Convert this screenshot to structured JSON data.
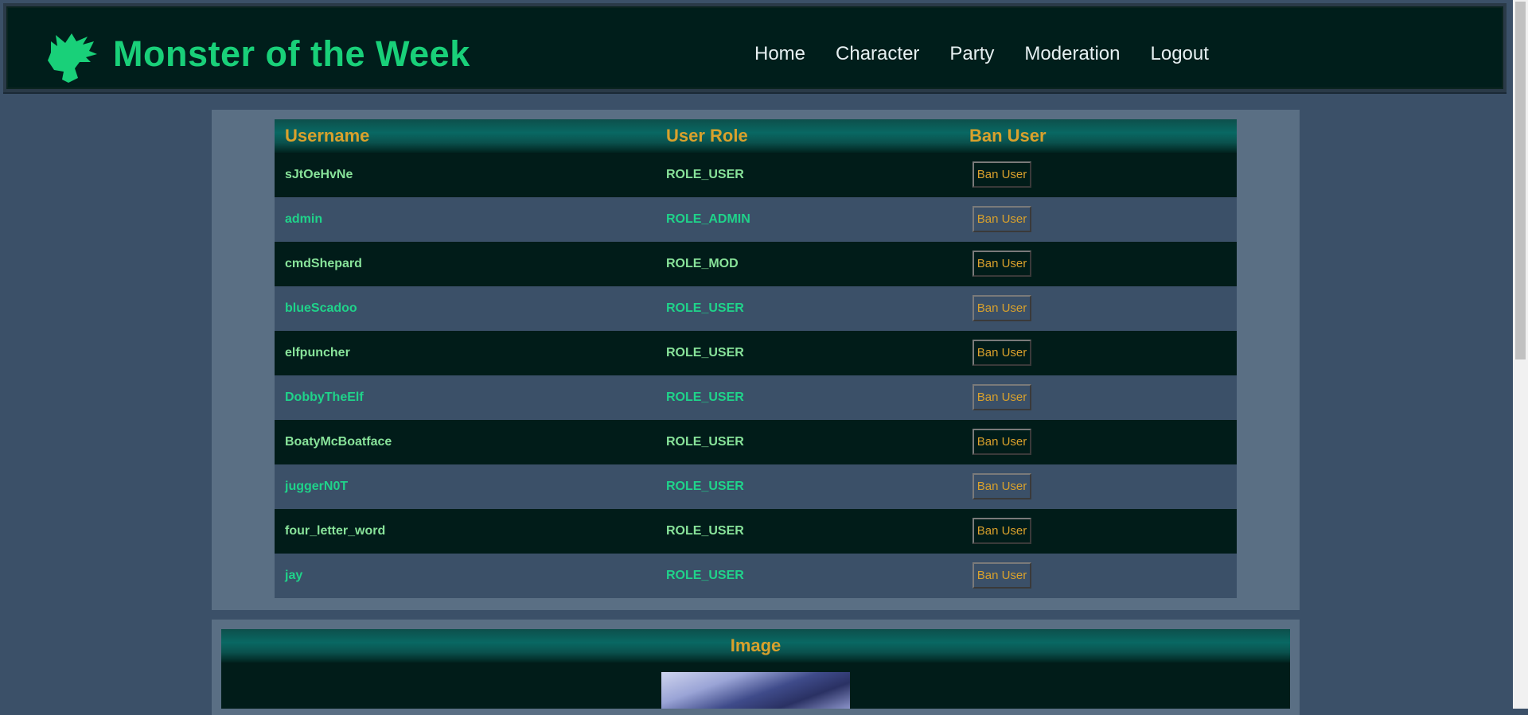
{
  "header": {
    "brand": "Monster of the Week",
    "nav": [
      "Home",
      "Character",
      "Party",
      "Moderation",
      "Logout"
    ]
  },
  "table": {
    "columns": [
      "Username",
      "User Role",
      "Ban User"
    ],
    "ban_label": "Ban User",
    "rows": [
      {
        "username": "sJtOeHvNe",
        "role": "ROLE_USER"
      },
      {
        "username": "admin",
        "role": "ROLE_ADMIN"
      },
      {
        "username": "cmdShepard",
        "role": "ROLE_MOD"
      },
      {
        "username": "blueScadoo",
        "role": "ROLE_USER"
      },
      {
        "username": "elfpuncher",
        "role": "ROLE_USER"
      },
      {
        "username": "DobbyTheElf",
        "role": "ROLE_USER"
      },
      {
        "username": "BoatyMcBoatface",
        "role": "ROLE_USER"
      },
      {
        "username": "juggerN0T",
        "role": "ROLE_USER"
      },
      {
        "username": "four_letter_word",
        "role": "ROLE_USER"
      },
      {
        "username": "jay",
        "role": "ROLE_USER"
      }
    ]
  },
  "image_section": {
    "heading": "Image"
  },
  "colors": {
    "brand": "#19d079",
    "heading": "#d9a12c",
    "dark_row": "#011c19",
    "light_row": "#3b5068"
  },
  "icons": {
    "logo": "dragon-head-icon"
  }
}
